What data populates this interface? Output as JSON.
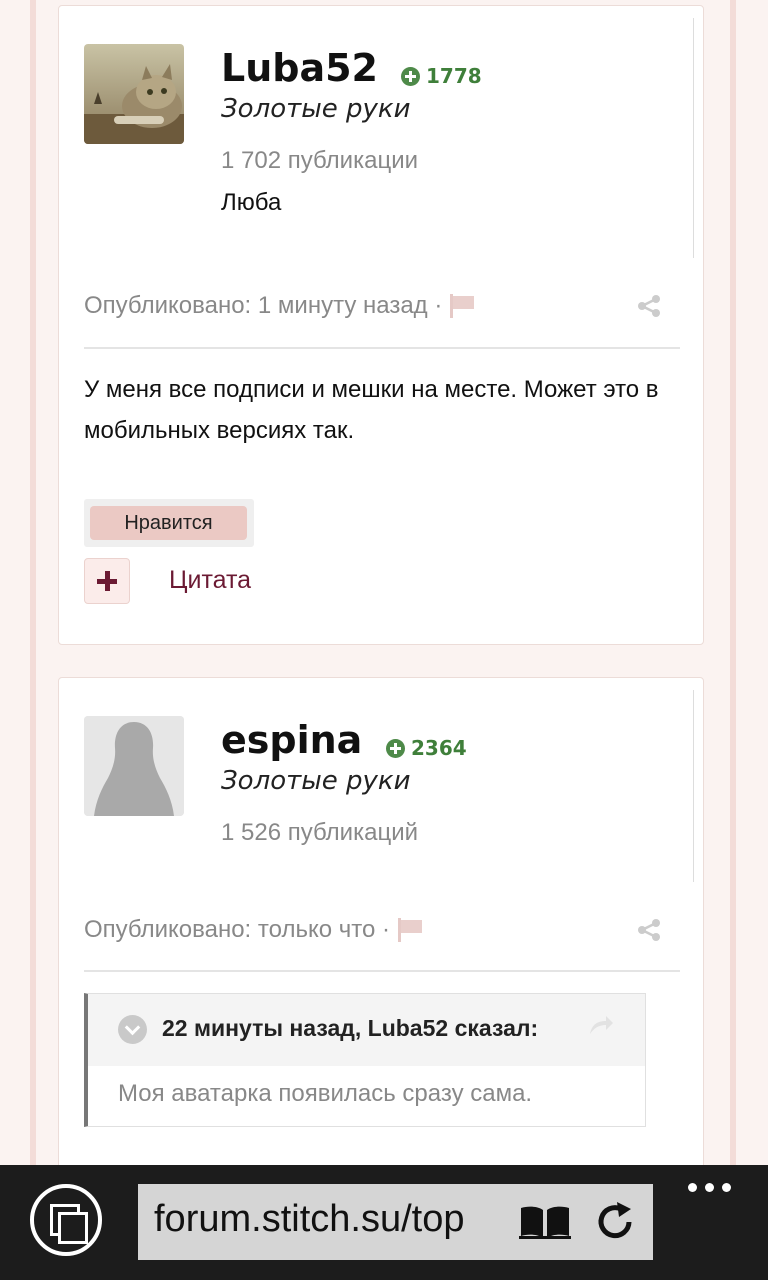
{
  "posts": [
    {
      "username": "Luba52",
      "reputation": "1778",
      "rank": "Золотые руки",
      "post_count": "1 702 публикации",
      "real_name": "Люба",
      "meta_text": "Опубликовано: 1 минуту назад ·",
      "body": "У меня все подписи и мешки на месте. Может это в мобильных версиях так.",
      "like_label": "Нравится",
      "quote_label": "Цитата"
    },
    {
      "username": "espina",
      "reputation": "2364",
      "rank": "Золотые руки",
      "post_count": "1 526 публикаций",
      "meta_text": "Опубликовано: только что ·",
      "quote": {
        "author": "22 минуты назад, Luba52 сказал:",
        "text": "Моя аватарка появилась сразу сама."
      }
    }
  ],
  "browser": {
    "url": "forum.stitch.su/top"
  },
  "colors": {
    "accent": "#6b1a33",
    "reputation": "#3f7f3a",
    "background": "#fbf3f1"
  }
}
